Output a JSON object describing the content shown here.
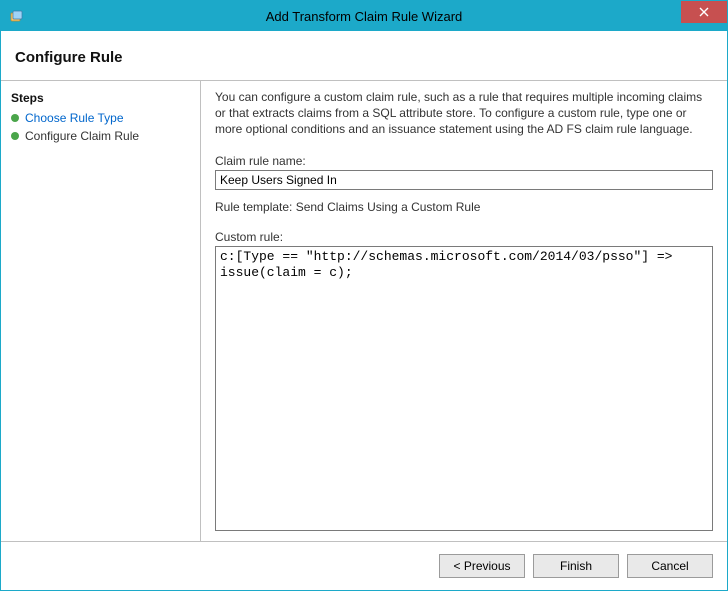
{
  "window": {
    "title": "Add Transform Claim Rule Wizard"
  },
  "header": {
    "title": "Configure Rule"
  },
  "sidebar": {
    "title": "Steps",
    "items": [
      {
        "label": "Choose Rule Type",
        "state": "done"
      },
      {
        "label": "Configure Claim Rule",
        "state": "current"
      }
    ]
  },
  "main": {
    "description": "You can configure a custom claim rule, such as a rule that requires multiple incoming claims or that extracts claims from a SQL attribute store. To configure a custom rule, type one or more optional conditions and an issuance statement using the AD FS claim rule language.",
    "rule_name_label": "Claim rule name:",
    "rule_name_value": "Keep Users Signed In",
    "template_label": "Rule template: Send Claims Using a Custom Rule",
    "custom_rule_label": "Custom rule:",
    "custom_rule_value": "c:[Type == \"http://schemas.microsoft.com/2014/03/psso\"] => issue(claim = c);"
  },
  "buttons": {
    "previous": "< Previous",
    "finish": "Finish",
    "cancel": "Cancel"
  }
}
